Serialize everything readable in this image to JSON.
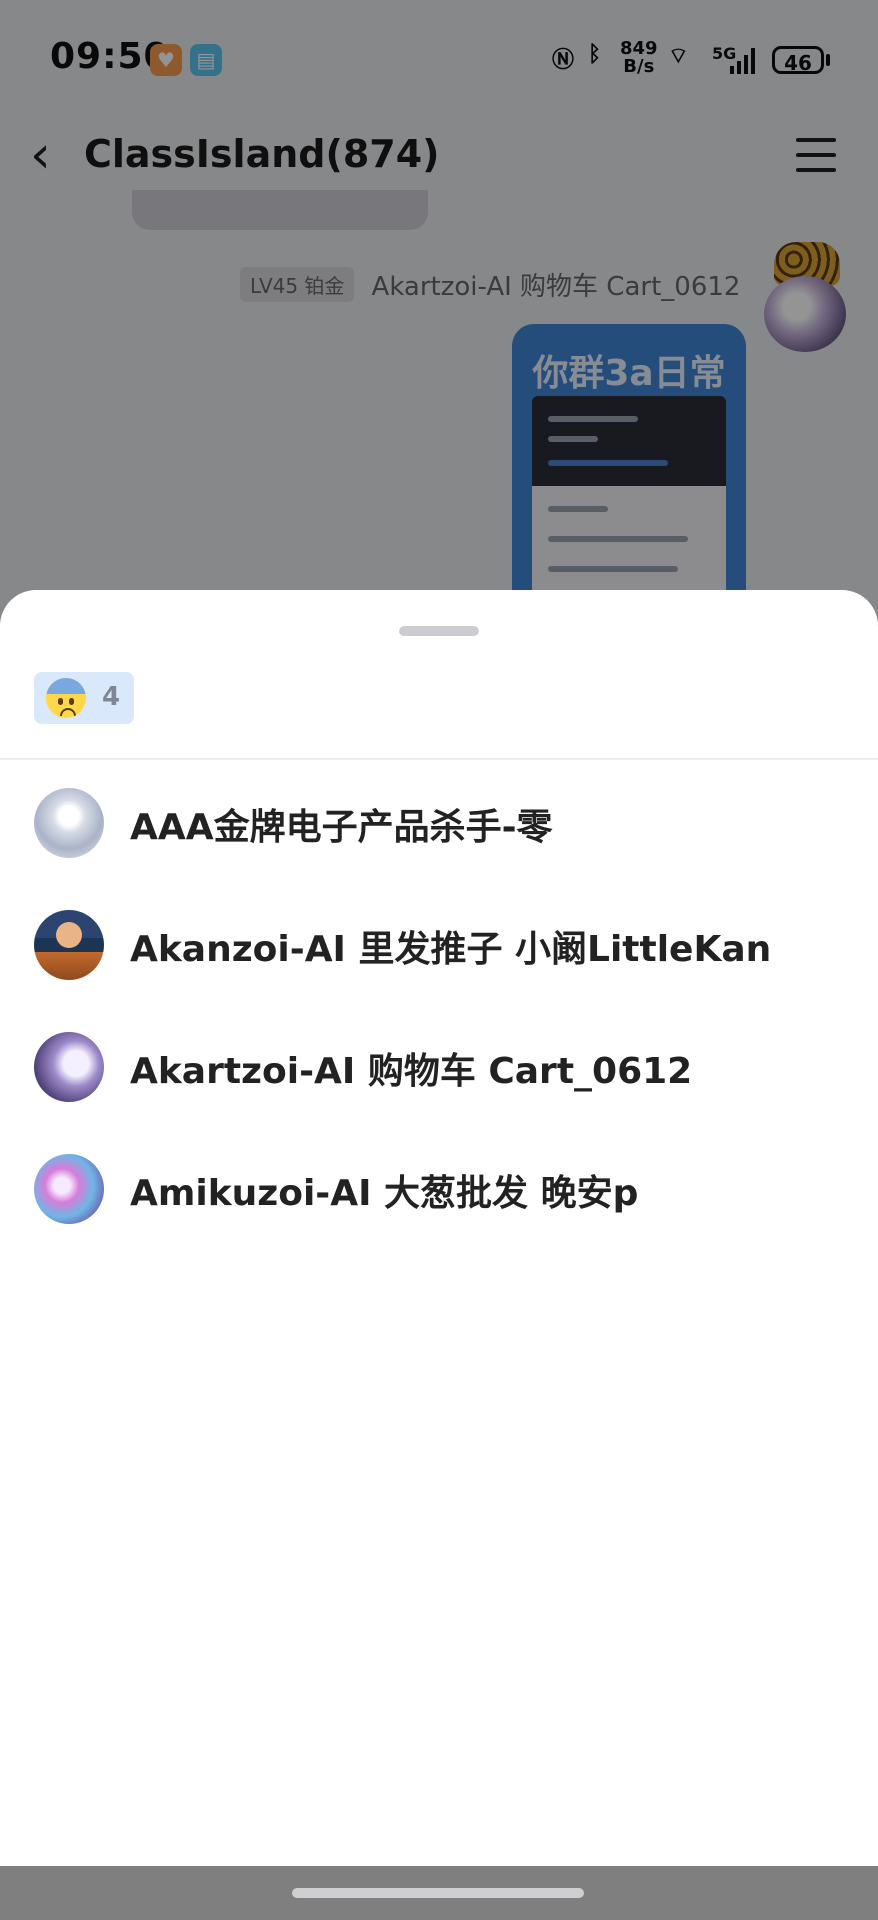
{
  "status_bar": {
    "time": "09:50",
    "net_speed_top": "849",
    "net_speed_bottom": "B/s",
    "network": "5G",
    "battery": "46",
    "icons": [
      "orange-app-icon",
      "blue-book-icon",
      "nfc-icon",
      "bluetooth-icon",
      "wifi-icon",
      "signal-icon",
      "battery-icon"
    ]
  },
  "chat": {
    "title": "ClassIsland(874)",
    "sender_level": "LV45 铂金",
    "sender_name": "Akartzoi-AI 购物车 Cart_0612",
    "bubble_text": "你群3a日常"
  },
  "sheet": {
    "reaction": {
      "emoji": "anxious-face-with-sweat",
      "count": "4"
    },
    "users": [
      {
        "name": "AAA金牌电子产品杀手-零",
        "avatar": "avatar-white-hair"
      },
      {
        "name": "Akanzoi-AI 里发推子 小阚LittleKan",
        "avatar": "avatar-fox-boy"
      },
      {
        "name": "Akartzoi-AI 购物车 Cart_0612",
        "avatar": "avatar-purple-hair"
      },
      {
        "name": "Amikuzoi-AI 大葱批发 晚安p",
        "avatar": "avatar-colorful-girl"
      }
    ]
  },
  "colors": {
    "sheet_background": "#ffffff",
    "reaction_chip": "#d9e9fb",
    "bubble": "#3f86d6",
    "overlay": "rgba(0,0,0,0.42)"
  }
}
